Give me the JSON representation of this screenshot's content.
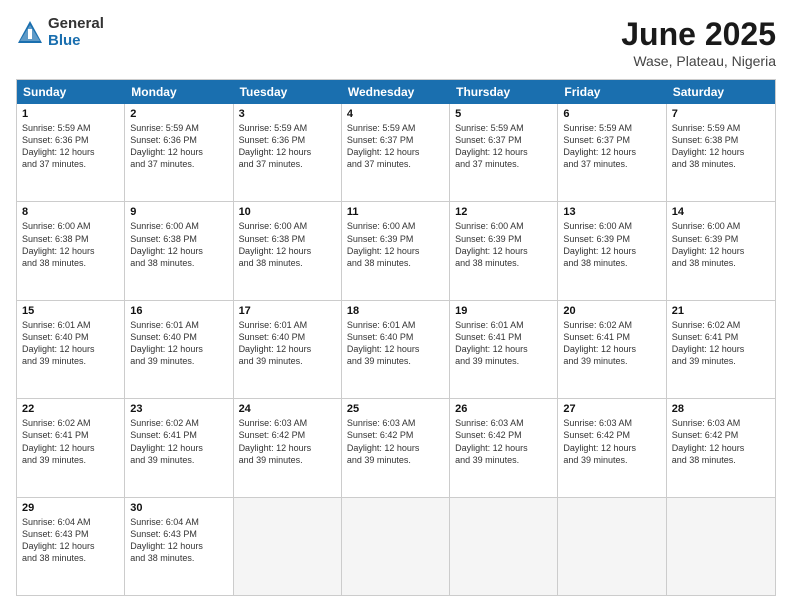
{
  "logo": {
    "general": "General",
    "blue": "Blue"
  },
  "title": "June 2025",
  "subtitle": "Wase, Plateau, Nigeria",
  "header_days": [
    "Sunday",
    "Monday",
    "Tuesday",
    "Wednesday",
    "Thursday",
    "Friday",
    "Saturday"
  ],
  "rows": [
    [
      {
        "day": "1",
        "lines": [
          "Sunrise: 5:59 AM",
          "Sunset: 6:36 PM",
          "Daylight: 12 hours",
          "and 37 minutes."
        ]
      },
      {
        "day": "2",
        "lines": [
          "Sunrise: 5:59 AM",
          "Sunset: 6:36 PM",
          "Daylight: 12 hours",
          "and 37 minutes."
        ]
      },
      {
        "day": "3",
        "lines": [
          "Sunrise: 5:59 AM",
          "Sunset: 6:36 PM",
          "Daylight: 12 hours",
          "and 37 minutes."
        ]
      },
      {
        "day": "4",
        "lines": [
          "Sunrise: 5:59 AM",
          "Sunset: 6:37 PM",
          "Daylight: 12 hours",
          "and 37 minutes."
        ]
      },
      {
        "day": "5",
        "lines": [
          "Sunrise: 5:59 AM",
          "Sunset: 6:37 PM",
          "Daylight: 12 hours",
          "and 37 minutes."
        ]
      },
      {
        "day": "6",
        "lines": [
          "Sunrise: 5:59 AM",
          "Sunset: 6:37 PM",
          "Daylight: 12 hours",
          "and 37 minutes."
        ]
      },
      {
        "day": "7",
        "lines": [
          "Sunrise: 5:59 AM",
          "Sunset: 6:38 PM",
          "Daylight: 12 hours",
          "and 38 minutes."
        ]
      }
    ],
    [
      {
        "day": "8",
        "lines": [
          "Sunrise: 6:00 AM",
          "Sunset: 6:38 PM",
          "Daylight: 12 hours",
          "and 38 minutes."
        ]
      },
      {
        "day": "9",
        "lines": [
          "Sunrise: 6:00 AM",
          "Sunset: 6:38 PM",
          "Daylight: 12 hours",
          "and 38 minutes."
        ]
      },
      {
        "day": "10",
        "lines": [
          "Sunrise: 6:00 AM",
          "Sunset: 6:38 PM",
          "Daylight: 12 hours",
          "and 38 minutes."
        ]
      },
      {
        "day": "11",
        "lines": [
          "Sunrise: 6:00 AM",
          "Sunset: 6:39 PM",
          "Daylight: 12 hours",
          "and 38 minutes."
        ]
      },
      {
        "day": "12",
        "lines": [
          "Sunrise: 6:00 AM",
          "Sunset: 6:39 PM",
          "Daylight: 12 hours",
          "and 38 minutes."
        ]
      },
      {
        "day": "13",
        "lines": [
          "Sunrise: 6:00 AM",
          "Sunset: 6:39 PM",
          "Daylight: 12 hours",
          "and 38 minutes."
        ]
      },
      {
        "day": "14",
        "lines": [
          "Sunrise: 6:00 AM",
          "Sunset: 6:39 PM",
          "Daylight: 12 hours",
          "and 38 minutes."
        ]
      }
    ],
    [
      {
        "day": "15",
        "lines": [
          "Sunrise: 6:01 AM",
          "Sunset: 6:40 PM",
          "Daylight: 12 hours",
          "and 39 minutes."
        ]
      },
      {
        "day": "16",
        "lines": [
          "Sunrise: 6:01 AM",
          "Sunset: 6:40 PM",
          "Daylight: 12 hours",
          "and 39 minutes."
        ]
      },
      {
        "day": "17",
        "lines": [
          "Sunrise: 6:01 AM",
          "Sunset: 6:40 PM",
          "Daylight: 12 hours",
          "and 39 minutes."
        ]
      },
      {
        "day": "18",
        "lines": [
          "Sunrise: 6:01 AM",
          "Sunset: 6:40 PM",
          "Daylight: 12 hours",
          "and 39 minutes."
        ]
      },
      {
        "day": "19",
        "lines": [
          "Sunrise: 6:01 AM",
          "Sunset: 6:41 PM",
          "Daylight: 12 hours",
          "and 39 minutes."
        ]
      },
      {
        "day": "20",
        "lines": [
          "Sunrise: 6:02 AM",
          "Sunset: 6:41 PM",
          "Daylight: 12 hours",
          "and 39 minutes."
        ]
      },
      {
        "day": "21",
        "lines": [
          "Sunrise: 6:02 AM",
          "Sunset: 6:41 PM",
          "Daylight: 12 hours",
          "and 39 minutes."
        ]
      }
    ],
    [
      {
        "day": "22",
        "lines": [
          "Sunrise: 6:02 AM",
          "Sunset: 6:41 PM",
          "Daylight: 12 hours",
          "and 39 minutes."
        ]
      },
      {
        "day": "23",
        "lines": [
          "Sunrise: 6:02 AM",
          "Sunset: 6:41 PM",
          "Daylight: 12 hours",
          "and 39 minutes."
        ]
      },
      {
        "day": "24",
        "lines": [
          "Sunrise: 6:03 AM",
          "Sunset: 6:42 PM",
          "Daylight: 12 hours",
          "and 39 minutes."
        ]
      },
      {
        "day": "25",
        "lines": [
          "Sunrise: 6:03 AM",
          "Sunset: 6:42 PM",
          "Daylight: 12 hours",
          "and 39 minutes."
        ]
      },
      {
        "day": "26",
        "lines": [
          "Sunrise: 6:03 AM",
          "Sunset: 6:42 PM",
          "Daylight: 12 hours",
          "and 39 minutes."
        ]
      },
      {
        "day": "27",
        "lines": [
          "Sunrise: 6:03 AM",
          "Sunset: 6:42 PM",
          "Daylight: 12 hours",
          "and 39 minutes."
        ]
      },
      {
        "day": "28",
        "lines": [
          "Sunrise: 6:03 AM",
          "Sunset: 6:42 PM",
          "Daylight: 12 hours",
          "and 38 minutes."
        ]
      }
    ],
    [
      {
        "day": "29",
        "lines": [
          "Sunrise: 6:04 AM",
          "Sunset: 6:43 PM",
          "Daylight: 12 hours",
          "and 38 minutes."
        ]
      },
      {
        "day": "30",
        "lines": [
          "Sunrise: 6:04 AM",
          "Sunset: 6:43 PM",
          "Daylight: 12 hours",
          "and 38 minutes."
        ]
      },
      {
        "day": "",
        "lines": []
      },
      {
        "day": "",
        "lines": []
      },
      {
        "day": "",
        "lines": []
      },
      {
        "day": "",
        "lines": []
      },
      {
        "day": "",
        "lines": []
      }
    ]
  ]
}
